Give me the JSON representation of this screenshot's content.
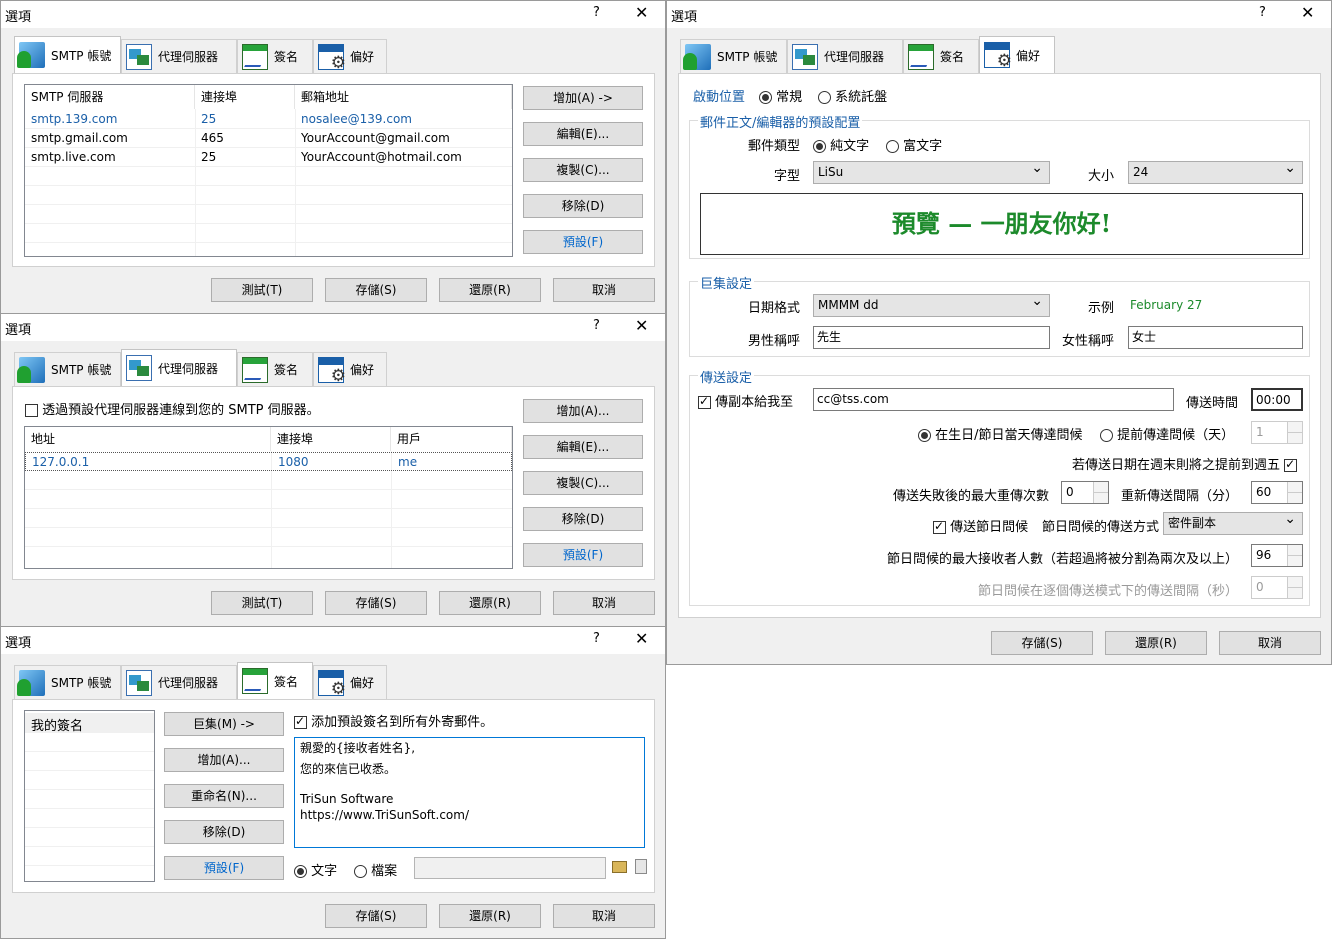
{
  "common": {
    "title": "選項",
    "help": "?",
    "close": "✕"
  },
  "tabs": {
    "smtp": "SMTP 帳號",
    "proxy": "代理伺服器",
    "sign": "簽名",
    "pref": "偏好"
  },
  "buttons": {
    "test": "測試(T)",
    "save": "存儲(S)",
    "restore": "還原(R)",
    "cancel": "取消",
    "add_arrow": "增加(A) ->",
    "add": "增加(A)...",
    "edit": "編輯(E)...",
    "copy": "複製(C)...",
    "remove": "移除(D)",
    "default": "預設(F)",
    "macro": "巨集(M) ->",
    "rename": "重命名(N)..."
  },
  "smtp": {
    "headers": [
      "SMTP 伺服器",
      "連接埠",
      "郵箱地址"
    ],
    "rows": [
      [
        "smtp.139.com",
        "25",
        "nosalee@139.com"
      ],
      [
        "smtp.gmail.com",
        "465",
        "YourAccount@gmail.com"
      ],
      [
        "smtp.live.com",
        "25",
        "YourAccount@hotmail.com"
      ]
    ]
  },
  "proxy": {
    "checkbox": "透過預設代理伺服器連線到您的 SMTP 伺服器。",
    "headers": [
      "地址",
      "連接埠",
      "用戶"
    ],
    "rows": [
      [
        "127.0.0.1",
        "1080",
        "me"
      ]
    ]
  },
  "sign": {
    "list": [
      "我的簽名"
    ],
    "checkbox": "添加預設簽名到所有外寄郵件。",
    "body": [
      "親愛的{接收者姓名},",
      "",
      "您的來信已收悉。",
      "",
      "TriSun Software",
      "https://www.TriSunSoft.com/"
    ],
    "radio_text": "文字",
    "radio_file": "檔案"
  },
  "pref": {
    "startup_label": "啟動位置",
    "startup_normal": "常規",
    "startup_tray": "系統託盤",
    "g1_title": "郵件正文/編輯器的預設配置",
    "mail_type": "郵件類型",
    "plain": "純文字",
    "rich": "富文字",
    "font_label": "字型",
    "font_value": "LiSu",
    "size_label": "大小",
    "size_value": "24",
    "preview": "預覽 — 一朋友你好!",
    "g2_title": "巨集設定",
    "date_label": "日期格式",
    "date_value": "MMMM dd",
    "example_label": "示例",
    "example_value": "February 27",
    "male_label": "男性稱呼",
    "male_value": "先生",
    "female_label": "女性稱呼",
    "female_value": "女士",
    "g3_title": "傳送設定",
    "cc_label": "傳副本給我至",
    "cc_value": "cc@tss.com",
    "time_label": "傳送時間",
    "time_value": "00:00",
    "on_day": "在生日/節日當天傳達問候",
    "ahead": "提前傳達問候（天）",
    "ahead_value": "1",
    "weekend": "若傳送日期在週末則將之提前到週五",
    "retry_label": "傳送失敗後的最大重傳次數",
    "retry_value": "0",
    "interval_label": "重新傳送間隔（分）",
    "interval_value": "60",
    "send_greet": "傳送節日問候",
    "greet_method_label": "節日問候的傳送方式",
    "greet_method": "密件副本",
    "max_recv_label": "節日問候的最大接收者人數（若超過將被分割為兩次及以上）",
    "max_recv_value": "96",
    "gap_label": "節日問候在逐個傳送模式下的傳送間隔（秒）",
    "gap_value": "0"
  }
}
